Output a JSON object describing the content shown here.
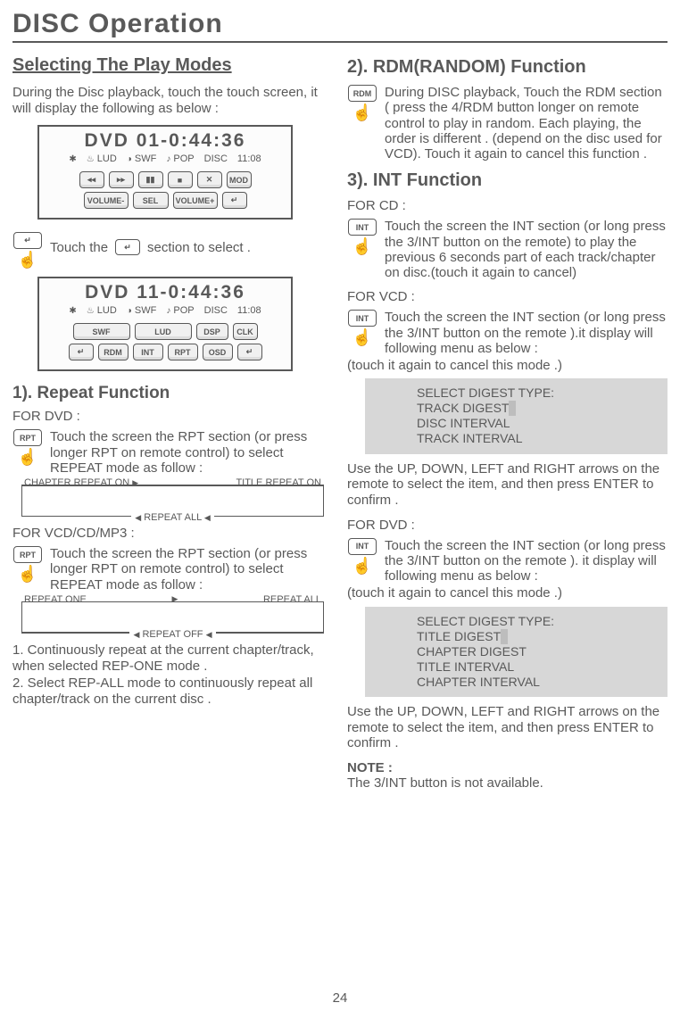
{
  "page": {
    "title": "DISC Operation",
    "number": "24"
  },
  "left": {
    "selecting_h": "Selecting The Play Modes",
    "selecting_p": "During the Disc playback, touch the touch screen, it will display the following as below :",
    "screen1": {
      "title": "DVD    01-0:44:36",
      "lud": "LUD",
      "swf": "SWF",
      "pop": "POP",
      "disc": "DISC",
      "time": "11:08",
      "btns1": {
        "prev": "◂◂",
        "next": "▸▸",
        "pause": "▮▮",
        "stop": "■",
        "mute": "✕",
        "mod": "MOD"
      },
      "btns2": {
        "volm": "VOLUME-",
        "sel": "SEL",
        "volp": "VOLUME+",
        "ret": "↵"
      }
    },
    "touch_line_a": "Touch the",
    "touch_line_b": "section to select .",
    "screen2": {
      "title": "DVD   11-0:44:36",
      "lud": "LUD",
      "swf": "SWF",
      "pop": "POP",
      "disc": "DISC",
      "time": "11:08",
      "btns1": {
        "swf": "SWF",
        "lud": "LUD",
        "dsp": "DSP",
        "clk": "CLK"
      },
      "btns2": {
        "ret": "↵",
        "rdm": "RDM",
        "int": "INT",
        "rpt": "RPT",
        "osd": "OSD",
        "ret2": "↵"
      }
    },
    "repeat_h": "1). Repeat Function",
    "for_dvd": "FOR  DVD :",
    "rpt_btn": "RPT",
    "rpt_dvd_p": "Touch the screen the RPT section (or press longer RPT on remote control) to select REPEAT mode as follow :",
    "flow1": {
      "a": "CHAPTER REPEAT ON",
      "b": "TITLE REPEAT ON",
      "c": "REPEAT ALL"
    },
    "for_vcd": "FOR  VCD/CD/MP3 :",
    "rpt_vcd_p": "Touch the screen the RPT section (or press longer RPT on remote control) to select REPEAT mode as follow :",
    "flow2": {
      "a": "REPEAT ONE",
      "b": "REPEAT ALL",
      "c": "REPEAT OFF"
    },
    "list1": "1. Continuously repeat at the current chapter/track, when selected REP-ONE mode .",
    "list2": "2. Select REP-ALL mode to continuously repeat  all chapter/track on the current disc ."
  },
  "right": {
    "rdm_h": "2). RDM(RANDOM) Function",
    "rdm_btn": "RDM",
    "rdm_p": "During DISC playback, Touch the RDM section ( press the 4/RDM button longer on remote control to play in random. Each playing, the order is different . (depend on the disc used for VCD). Touch it again to cancel this function .",
    "int_h": "3). INT Function",
    "for_cd": "FOR CD :",
    "int_btn": "INT",
    "int_cd_p": "Touch the screen the INT section (or long press the 3/INT button on the remote) to play the previous 6 seconds part of each track/chapter on disc.(touch it again to cancel)",
    "for_vcd": "FOR VCD :",
    "int_vcd_p": "Touch the screen the INT section (or long press the 3/INT button on the remote ).it display will following menu as below :",
    "cancel1": "(touch it again to cancel this mode .)",
    "digest1": {
      "h": "SELECT DIGEST TYPE:",
      "a": "TRACK DIGEST",
      "b": "DISC INTERVAL",
      "c": "TRACK INTERVAL"
    },
    "use1": "Use the UP, DOWN, LEFT and RIGHT arrows on the remote to select the item, and then press ENTER to confirm .",
    "for_dvd": "FOR DVD :",
    "int_dvd_p": "Touch the screen the INT section (or long press the 3/INT button on the remote ). it display will following menu as below :",
    "cancel2": "(touch it again to cancel this mode .)",
    "digest2": {
      "h": "SELECT DIGEST TYPE:",
      "a": "TITLE DIGEST",
      "b": "CHAPTER DIGEST",
      "c": "TITLE INTERVAL",
      "d": "CHAPTER INTERVAL"
    },
    "use2": "Use the UP, DOWN, LEFT and RIGHT arrows on the remote to select the item, and then press ENTER to confirm .",
    "note_h": "NOTE :",
    "note_p": "The 3/INT button is not available."
  }
}
